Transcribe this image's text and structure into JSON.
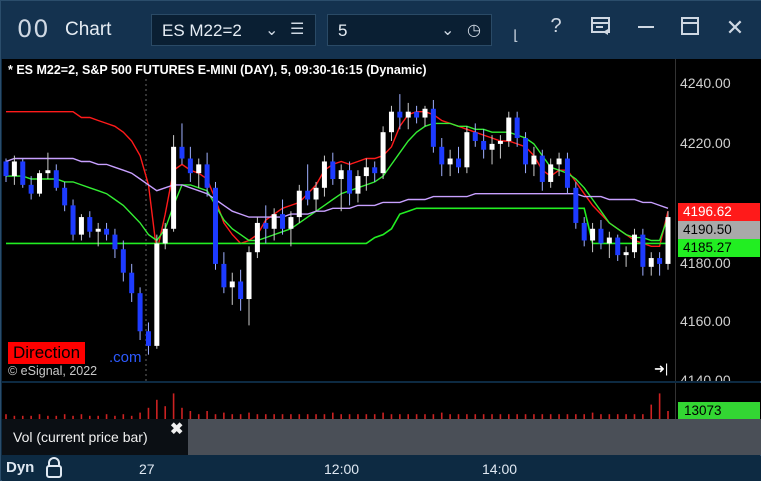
{
  "window": {
    "app_icon": "00",
    "title": "Chart",
    "symbol": "ES M22=2",
    "interval": "5",
    "buttons": [
      "draw-tool-icon",
      "help-icon",
      "layout-icon",
      "maximize-icon",
      "close-icon"
    ],
    "help_glyph": "?",
    "close_glyph": "✕"
  },
  "chart": {
    "header": "* ES M22=2, S&P 500 FUTURES E-MINI (DAY), 5, 09:30-16:15 (Dynamic)",
    "direction_label": "Direction",
    "direction_suffix": ".com",
    "copyright": "© eSignal, 2022",
    "go_live_glyph": "➜|"
  },
  "price_axis": {
    "ticks": [
      "4240.00",
      "4220.00",
      "4160.00",
      "4140.00"
    ],
    "partial_tick": "4180.00",
    "labels": [
      {
        "text": "4196.62",
        "bg": "#ff1a1a",
        "fg": "#ffffff"
      },
      {
        "text": "4190.50",
        "bg": "#a9a9a9",
        "fg": "#000000"
      },
      {
        "text": "4185.27",
        "bg": "#22ee22",
        "fg": "#000000"
      }
    ]
  },
  "chart_data": {
    "type": "candlestick",
    "ylim": [
      4138,
      4248
    ],
    "candles_ohlc": [
      [
        4213,
        4214,
        4206,
        4208
      ],
      [
        4208,
        4215,
        4205,
        4213
      ],
      [
        4213,
        4214,
        4204,
        4205
      ],
      [
        4205,
        4208,
        4200,
        4202
      ],
      [
        4202,
        4210,
        4201,
        4209
      ],
      [
        4209,
        4216,
        4207,
        4210
      ],
      [
        4210,
        4212,
        4203,
        4204
      ],
      [
        4204,
        4206,
        4196,
        4198
      ],
      [
        4198,
        4200,
        4186,
        4188
      ],
      [
        4188,
        4195,
        4186,
        4194
      ],
      [
        4194,
        4196,
        4187,
        4189
      ],
      [
        4189,
        4192,
        4184,
        4190
      ],
      [
        4190,
        4192,
        4186,
        4188
      ],
      [
        4188,
        4190,
        4180,
        4183
      ],
      [
        4183,
        4186,
        4172,
        4175
      ],
      [
        4175,
        4178,
        4165,
        4168
      ],
      [
        4168,
        4170,
        4152,
        4155
      ],
      [
        4155,
        4158,
        4147,
        4150
      ],
      [
        4150,
        4188,
        4149,
        4185
      ],
      [
        4185,
        4192,
        4183,
        4190
      ],
      [
        4190,
        4222,
        4189,
        4218
      ],
      [
        4218,
        4226,
        4212,
        4214
      ],
      [
        4214,
        4218,
        4206,
        4209
      ],
      [
        4209,
        4214,
        4204,
        4212
      ],
      [
        4212,
        4216,
        4201,
        4204
      ],
      [
        4204,
        4206,
        4176,
        4178
      ],
      [
        4178,
        4182,
        4168,
        4170
      ],
      [
        4170,
        4175,
        4164,
        4172
      ],
      [
        4172,
        4176,
        4162,
        4166
      ],
      [
        4166,
        4184,
        4157,
        4182
      ],
      [
        4182,
        4194,
        4180,
        4192
      ],
      [
        4192,
        4198,
        4185,
        4190
      ],
      [
        4190,
        4197,
        4186,
        4195
      ],
      [
        4195,
        4200,
        4188,
        4190
      ],
      [
        4190,
        4196,
        4184,
        4194
      ],
      [
        4194,
        4205,
        4192,
        4203
      ],
      [
        4203,
        4212,
        4198,
        4200
      ],
      [
        4200,
        4206,
        4196,
        4204
      ],
      [
        4204,
        4215,
        4201,
        4213
      ],
      [
        4213,
        4216,
        4205,
        4207
      ],
      [
        4207,
        4212,
        4196,
        4210
      ],
      [
        4210,
        4213,
        4198,
        4202
      ],
      [
        4202,
        4210,
        4199,
        4208
      ],
      [
        4208,
        4214,
        4203,
        4211
      ],
      [
        4211,
        4213,
        4206,
        4209
      ],
      [
        4209,
        4225,
        4207,
        4223
      ],
      [
        4223,
        4232,
        4220,
        4230
      ],
      [
        4230,
        4236,
        4224,
        4228
      ],
      [
        4228,
        4233,
        4224,
        4230
      ],
      [
        4230,
        4232,
        4226,
        4228
      ],
      [
        4228,
        4232,
        4225,
        4231
      ],
      [
        4231,
        4234,
        4216,
        4218
      ],
      [
        4218,
        4221,
        4208,
        4212
      ],
      [
        4212,
        4217,
        4208,
        4214
      ],
      [
        4214,
        4218,
        4209,
        4211
      ],
      [
        4211,
        4225,
        4209,
        4223
      ],
      [
        4223,
        4226,
        4218,
        4220
      ],
      [
        4220,
        4224,
        4214,
        4217
      ],
      [
        4217,
        4222,
        4212,
        4219
      ],
      [
        4219,
        4222,
        4214,
        4220
      ],
      [
        4220,
        4230,
        4218,
        4228
      ],
      [
        4228,
        4230,
        4218,
        4221
      ],
      [
        4221,
        4223,
        4209,
        4212
      ],
      [
        4212,
        4218,
        4208,
        4215
      ],
      [
        4215,
        4217,
        4203,
        4206
      ],
      [
        4206,
        4214,
        4204,
        4212
      ],
      [
        4212,
        4216,
        4208,
        4214
      ],
      [
        4214,
        4216,
        4202,
        4204
      ],
      [
        4204,
        4206,
        4190,
        4192
      ],
      [
        4192,
        4194,
        4184,
        4186
      ],
      [
        4186,
        4192,
        4182,
        4190
      ],
      [
        4190,
        4193,
        4183,
        4185
      ],
      [
        4185,
        4189,
        4180,
        4187
      ],
      [
        4187,
        4188,
        4179,
        4181
      ],
      [
        4181,
        4184,
        4177,
        4182
      ],
      [
        4182,
        4190,
        4180,
        4188
      ],
      [
        4188,
        4190,
        4174,
        4177
      ],
      [
        4177,
        4182,
        4174,
        4180
      ],
      [
        4180,
        4182,
        4174,
        4178
      ],
      [
        4178,
        4196,
        4176,
        4194
      ]
    ],
    "series": [
      {
        "color": "#ff1a1a",
        "values": [
          4230,
          4230,
          4230,
          4230,
          4230,
          4230,
          4230,
          4230,
          4230,
          4228,
          4228,
          4227,
          4226,
          4225,
          4223,
          4220,
          4215,
          4205,
          4182,
          4195,
          4210,
          4212,
          4210,
          4209,
          4207,
          4200,
          4192,
          4188,
          4185,
          4186,
          4188,
          4193,
          4195,
          4197,
          4198,
          4199,
          4202,
          4205,
          4210,
          4212,
          4213,
          4212,
          4213,
          4214,
          4214,
          4215,
          4218,
          4225,
          4229,
          4230,
          4230,
          4229,
          4227,
          4226,
          4225,
          4224,
          4223,
          4222,
          4221,
          4220,
          4220,
          4219,
          4218,
          4215,
          4210,
          4208,
          4210,
          4210,
          4206,
          4202,
          4198,
          4195,
          4192,
          4190,
          4188,
          4186,
          4185,
          4184,
          4184,
          4196
        ]
      },
      {
        "color": "#33ee33",
        "values": [
          4208,
          4208,
          4208,
          4207,
          4207,
          4207,
          4207,
          4206,
          4206,
          4205,
          4204,
          4203,
          4202,
          4200,
          4198,
          4195,
          4192,
          4188,
          4186,
          4190,
          4198,
          4205,
          4205,
          4204,
          4203,
          4198,
          4193,
          4190,
          4188,
          4186,
          4186,
          4187,
          4188,
          4189,
          4190,
          4192,
          4194,
          4196,
          4198,
          4200,
          4202,
          4203,
          4204,
          4205,
          4206,
          4208,
          4212,
          4216,
          4220,
          4223,
          4225,
          4226,
          4226,
          4226,
          4225,
          4225,
          4224,
          4224,
          4223,
          4223,
          4223,
          4222,
          4221,
          4219,
          4215,
          4211,
          4210,
          4209,
          4207,
          4204,
          4200,
          4196,
          4192,
          4190,
          4188,
          4187,
          4187,
          4186,
          4186,
          4194
        ]
      },
      {
        "color": "#c8a0ff",
        "values": [
          4213,
          4214,
          4214,
          4214,
          4214,
          4214,
          4214,
          4214,
          4214,
          4213,
          4213,
          4212,
          4212,
          4211,
          4210,
          4209,
          4207,
          4205,
          4203,
          4204,
          4205,
          4205,
          4204,
          4203,
          4202,
          4200,
          4198,
          4196,
          4195,
          4194,
          4194,
          4194,
          4194,
          4194,
          4195,
          4195,
          4195,
          4196,
          4196,
          4197,
          4197,
          4197,
          4198,
          4198,
          4198,
          4199,
          4199,
          4199,
          4200,
          4200,
          4200,
          4201,
          4201,
          4201,
          4201,
          4201,
          4202,
          4202,
          4202,
          4202,
          4202,
          4202,
          4202,
          4202,
          4202,
          4202,
          4202,
          4202,
          4202,
          4201,
          4201,
          4201,
          4200,
          4200,
          4200,
          4200,
          4199,
          4199,
          4198,
          4197
        ]
      },
      {
        "color": "#22ee22",
        "values": [
          4185,
          4185,
          4185,
          4185,
          4185,
          4185,
          4185,
          4185,
          4185,
          4185,
          4185,
          4185,
          4185,
          4185,
          4185,
          4185,
          4185,
          4185,
          4185,
          4185,
          4185,
          4185,
          4185,
          4185,
          4185,
          4185,
          4185,
          4185,
          4185,
          4185,
          4185,
          4185,
          4185,
          4185,
          4185,
          4185,
          4185,
          4185,
          4185,
          4185,
          4185,
          4185,
          4185,
          4185,
          4187,
          4188,
          4190,
          4195,
          4196,
          4197,
          4197,
          4197,
          4197,
          4197,
          4197,
          4197,
          4197,
          4197,
          4197,
          4197,
          4197,
          4197,
          4197,
          4197,
          4197,
          4197,
          4197,
          4197,
          4197,
          4197,
          4185,
          4185,
          4185,
          4185,
          4185,
          4185,
          4185,
          4185,
          4185,
          4185
        ]
      }
    ]
  },
  "volume": {
    "label": "13073",
    "tooltip": "Vol (current price bar)",
    "tooltip_close": "✖"
  },
  "time_axis": {
    "mode": "Dyn",
    "labels": [
      "27",
      "12:00",
      "14:00"
    ]
  }
}
